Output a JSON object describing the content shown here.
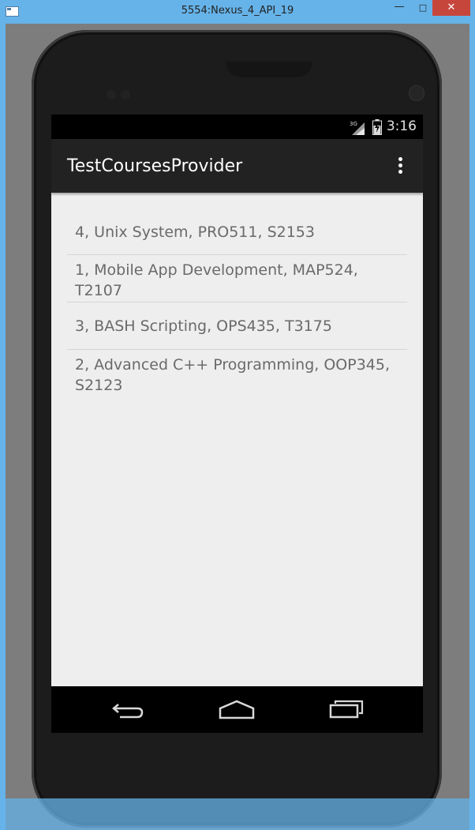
{
  "window": {
    "title": "5554:Nexus_4_API_19",
    "minimize": "—",
    "maximize": "□",
    "close": "✕"
  },
  "statusbar": {
    "network": "3G",
    "time": "3:16"
  },
  "actionbar": {
    "title": "TestCoursesProvider",
    "overflow_icon": "more-vert-icon"
  },
  "courses": [
    "4, Unix System, PRO511, S2153",
    "1, Mobile App Development, MAP524, T2107",
    "3, BASH Scripting, OPS435, T3175",
    "2, Advanced C++ Programming, OOP345, S2123"
  ],
  "navbar": {
    "back_icon": "back-icon",
    "home_icon": "home-icon",
    "recents_icon": "recents-icon"
  },
  "colors": {
    "window_frame": "#66b3e9",
    "close_button": "#c7463c",
    "actionbar": "#222222",
    "screen_bg": "#eeeeee",
    "list_text": "#6a6a6a"
  }
}
